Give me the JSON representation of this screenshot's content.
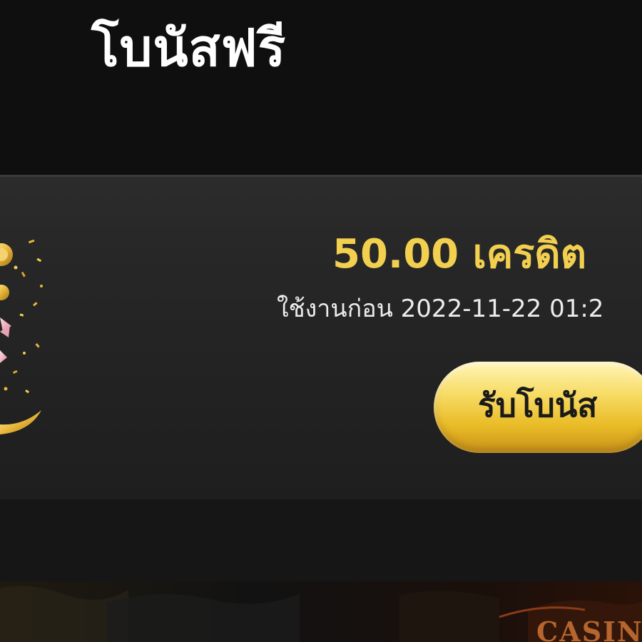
{
  "header": {
    "title": "โบนัสฟรี"
  },
  "bonus_card": {
    "amount": "50.00 เครดิต",
    "expiry": "ใช้งานก่อน 2022-11-22 01:2",
    "claim_label": "รับโบนัส",
    "decoration_icon": "confetti-moon-icon"
  },
  "banner": {
    "logo_text": "CASIN"
  },
  "colors": {
    "background": "#0f0f0f",
    "card": "#272727",
    "amount_gold": "#f2cf4f",
    "button_gold": "#f7dc66",
    "button_text": "#1a1a1a"
  }
}
